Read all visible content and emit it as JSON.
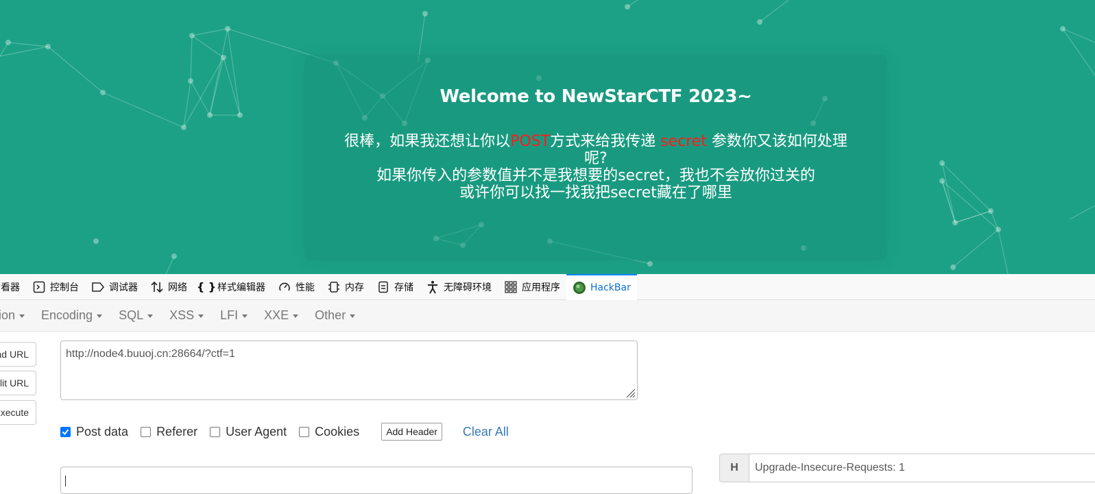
{
  "page": {
    "title": "Welcome to NewStarCTF 2023~",
    "line1_prefix": "很棒，如果我还想让你以",
    "line1_post": "POST",
    "line1_mid": "方式来给我传递 ",
    "line1_secret": "secret",
    "line1_suffix": " 参数你又该如何处理呢?",
    "line2": "如果你传入的参数值并不是我想要的secret，我也不会放你过关的",
    "line3": "或许你可以找一找我把secret藏在了哪里",
    "colors": {
      "background": "#1ca186",
      "highlight": "#ff1a1a"
    }
  },
  "devtools": {
    "tabs": [
      {
        "label": "查看器",
        "icon": "inspector-icon"
      },
      {
        "label": "控制台",
        "icon": "console-icon"
      },
      {
        "label": "调试器",
        "icon": "debugger-icon"
      },
      {
        "label": "网络",
        "icon": "network-icon"
      },
      {
        "label": "样式编辑器",
        "icon": "style-editor-icon"
      },
      {
        "label": "性能",
        "icon": "performance-icon"
      },
      {
        "label": "内存",
        "icon": "memory-icon"
      },
      {
        "label": "存储",
        "icon": "storage-icon"
      },
      {
        "label": "无障碍环境",
        "icon": "accessibility-icon"
      },
      {
        "label": "应用程序",
        "icon": "application-icon"
      },
      {
        "label": "HackBar",
        "icon": "hackbar-icon"
      }
    ],
    "active_tab": "HackBar"
  },
  "hackbar": {
    "menus": [
      "Encryption",
      "Encoding",
      "SQL",
      "XSS",
      "LFI",
      "XXE",
      "Other"
    ],
    "buttons": {
      "load_url": "Load URL",
      "split_url": "Split URL",
      "execute": "Execute"
    },
    "url_value": "http://node4.buuoj.cn:28664/?ctf=1",
    "options": {
      "post_data": {
        "label": "Post data",
        "checked": true
      },
      "referer": {
        "label": "Referer",
        "checked": false
      },
      "user_agent": {
        "label": "User Agent",
        "checked": false
      },
      "cookies": {
        "label": "Cookies",
        "checked": false
      }
    },
    "add_header_label": "Add Header",
    "clear_all_label": "Clear All",
    "post_body_value": "",
    "header": {
      "addon": "H",
      "value": "Upgrade-Insecure-Requests: 1"
    }
  }
}
